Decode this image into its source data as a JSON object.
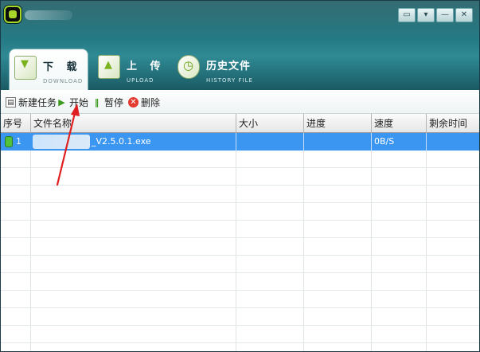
{
  "window": {
    "controls": [
      "▭",
      "▾",
      "—",
      "✕"
    ]
  },
  "tabs": [
    {
      "title": "下 载",
      "subtitle": "DOWNLOAD",
      "active": true
    },
    {
      "title": "上 传",
      "subtitle": "UPLOAD",
      "active": false
    },
    {
      "title": "历史文件",
      "subtitle": "HISTORY FILE",
      "active": false
    }
  ],
  "toolbar": {
    "new_task": "新建任务",
    "start": "开始",
    "pause": "暂停",
    "delete": "删除"
  },
  "grid": {
    "columns": [
      "序号",
      "文件名称",
      "大小",
      "进度",
      "速度",
      "剩余时间"
    ],
    "rows": [
      {
        "index": "1",
        "filename": "_V2.5.0.1.exe",
        "size": "",
        "progress": "",
        "speed": "0B/S",
        "remaining": "",
        "selected": true
      }
    ]
  },
  "colors": {
    "header": "#1e6f79",
    "selection": "#3b96f2",
    "annotation": "#e02020"
  },
  "icons": {
    "app": "app-logo-icon",
    "download_tab": "download-arrow-icon",
    "upload_tab": "upload-arrow-icon",
    "history_tab": "history-clock-icon",
    "new_task": "new-task-icon",
    "start": "play-icon",
    "pause": "pause-icon",
    "delete": "delete-icon"
  }
}
